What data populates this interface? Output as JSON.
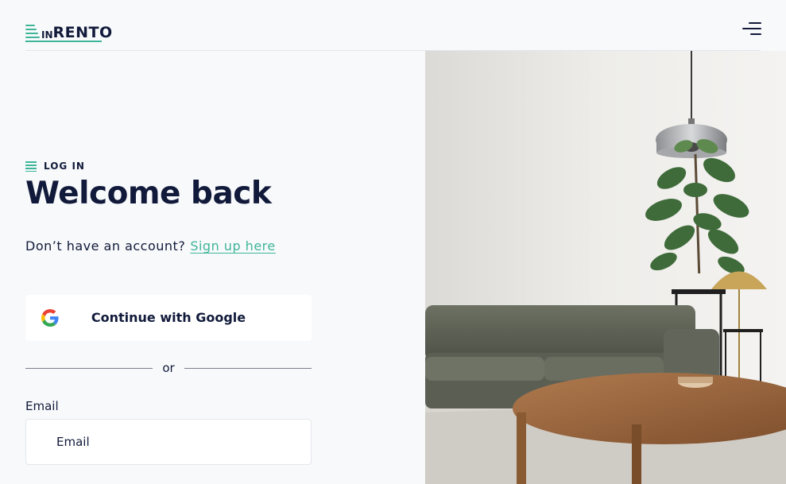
{
  "header": {
    "logo_small": "IN",
    "logo_main": "RENTO",
    "menu_icon": "hamburger-menu-icon"
  },
  "login": {
    "eyebrow": "LOG IN",
    "title": "Welcome back",
    "no_account_text": "Don’t have an account?",
    "signup_link": "Sign up here",
    "google_button": "Continue with Google",
    "divider_text": "or",
    "email_label": "Email",
    "email_placeholder": "Email"
  },
  "colors": {
    "accent": "#3fb59a",
    "text": "#111a3a",
    "background": "#f8f9fb"
  }
}
